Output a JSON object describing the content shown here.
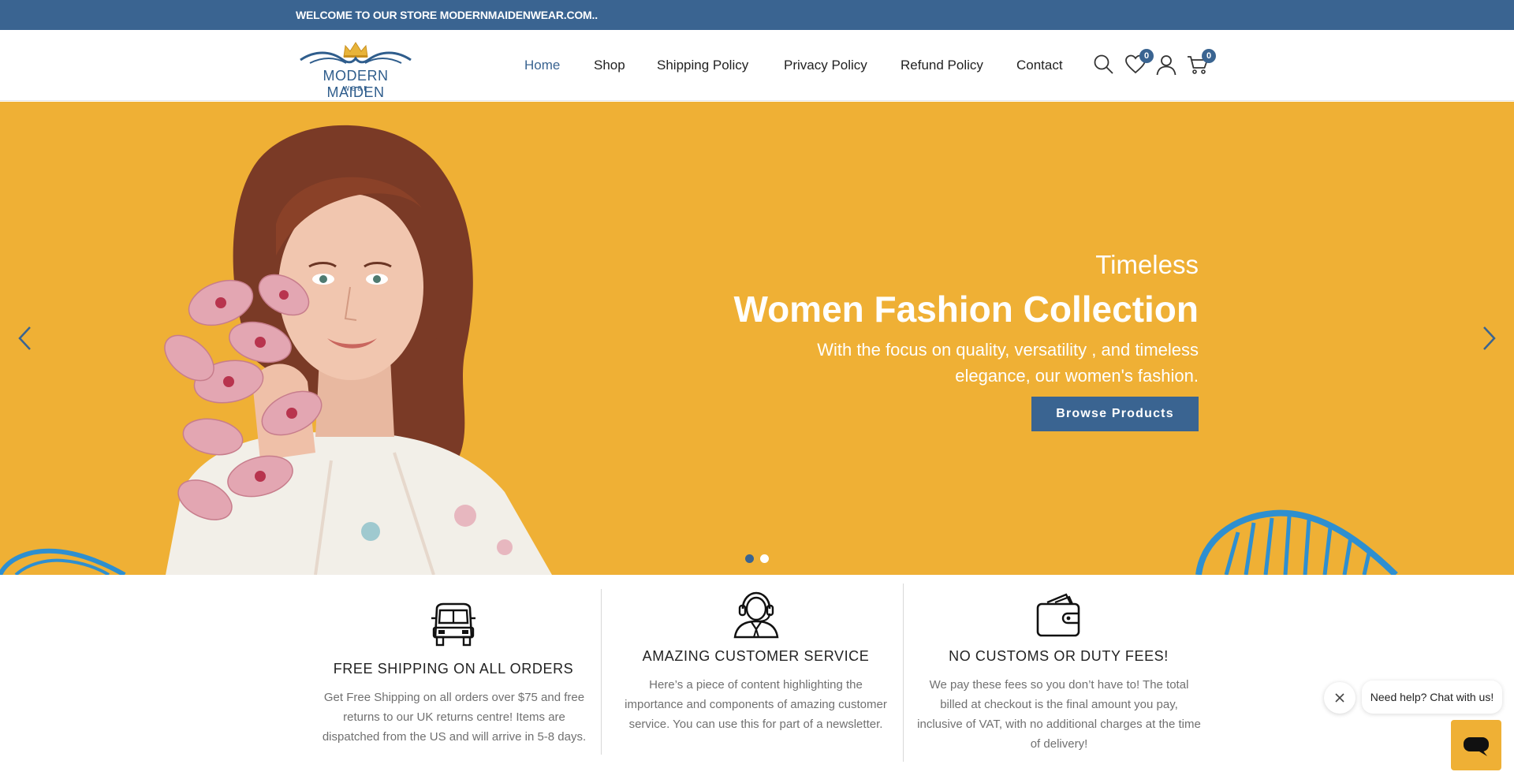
{
  "topbar": {
    "text": "WELCOME TO OUR STORE MODERNMAIDENWEAR.COM.."
  },
  "logo": {
    "main": "MODERN MAIDEN",
    "sub": "wear"
  },
  "nav": {
    "items": [
      {
        "label": "Home",
        "active": true
      },
      {
        "label": "Shop",
        "active": false
      },
      {
        "label": "Shipping Policy",
        "active": false
      },
      {
        "label": "Privacy Policy",
        "active": false
      },
      {
        "label": "Refund Policy",
        "active": false
      },
      {
        "label": "Contact",
        "active": false
      }
    ]
  },
  "header_icons": {
    "search": "search-icon",
    "wishlist": {
      "icon": "heart-icon",
      "count": "0"
    },
    "account": "user-icon",
    "cart": {
      "icon": "cart-icon",
      "count": "0"
    }
  },
  "hero": {
    "kicker": "Timeless",
    "title": "Women Fashion Collection",
    "description": "With the focus on quality, versatility , and timeless elegance, our women's fashion.",
    "button": "Browse Products",
    "slides": 2,
    "active_slide": 1
  },
  "features": [
    {
      "icon": "van-icon",
      "title": "FREE SHIPPING ON ALL ORDERS",
      "text": "Get Free Shipping on all orders over $75 and free returns to our UK returns centre! Items are dispatched from the US and will arrive in 5-8 days."
    },
    {
      "icon": "headset-agent-icon",
      "title": "AMAZING CUSTOMER SERVICE",
      "text": "Here’s a piece of content highlighting the importance and components of amazing customer service. You can use this for part of a newsletter."
    },
    {
      "icon": "wallet-icon",
      "title": "NO CUSTOMS OR DUTY FEES!",
      "text": "We pay these fees so you don’t have to! The total billed at checkout is the final amount you pay, inclusive of VAT, with no additional charges at the time of delivery!"
    }
  ],
  "chat": {
    "prompt": "Need help? Chat with us!"
  },
  "colors": {
    "brand": "#3a6491",
    "hero_bg": "#efb035",
    "accent_deco": "#2e8fd0"
  }
}
